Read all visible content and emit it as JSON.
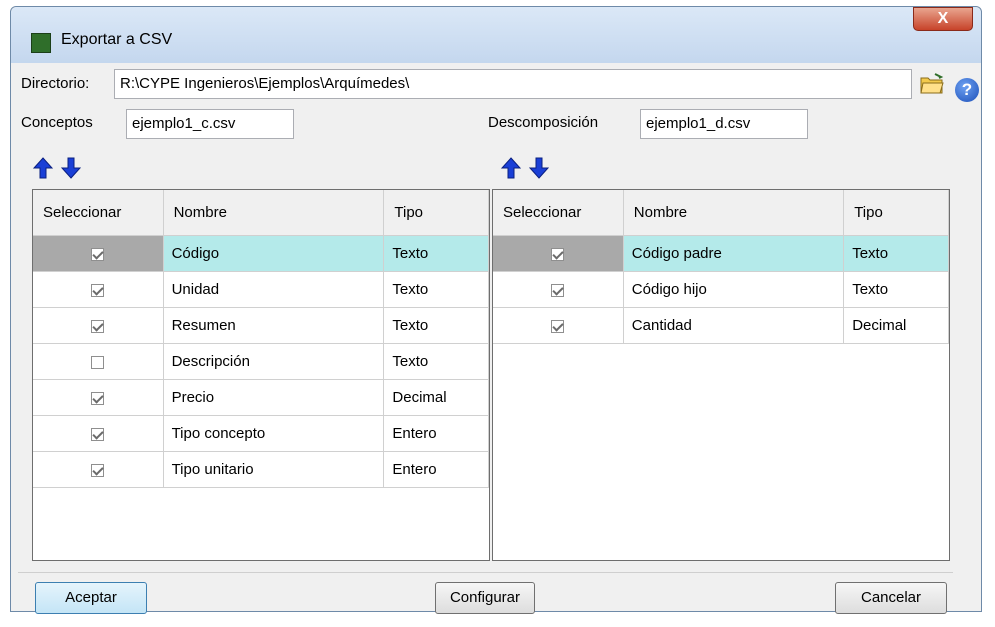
{
  "window": {
    "title": "Exportar a CSV",
    "close_glyph": "X"
  },
  "directory": {
    "label": "Directorio:",
    "value": "R:\\CYPE Ingenieros\\Ejemplos\\Arquímedes\\"
  },
  "conceptos": {
    "label": "Conceptos",
    "value": "ejemplo1_c.csv"
  },
  "descomposicion": {
    "label": "Descomposición",
    "value": "ejemplo1_d.csv"
  },
  "help_glyph": "?",
  "left_table": {
    "headers": [
      "Seleccionar",
      "Nombre",
      "Tipo"
    ],
    "rows": [
      {
        "name": "Código",
        "type": "Texto",
        "checked": true,
        "selected": true
      },
      {
        "name": "Unidad",
        "type": "Texto",
        "checked": true
      },
      {
        "name": "Resumen",
        "type": "Texto",
        "checked": true
      },
      {
        "name": "Descripción",
        "type": "Texto",
        "checked": false
      },
      {
        "name": "Precio",
        "type": "Decimal",
        "checked": true
      },
      {
        "name": "Tipo concepto",
        "type": "Entero",
        "checked": true
      },
      {
        "name": "Tipo unitario",
        "type": "Entero",
        "checked": true
      }
    ]
  },
  "right_table": {
    "headers": [
      "Seleccionar",
      "Nombre",
      "Tipo"
    ],
    "rows": [
      {
        "name": "Código padre",
        "type": "Texto",
        "checked": true,
        "selected": true
      },
      {
        "name": "Código hijo",
        "type": "Texto",
        "checked": true
      },
      {
        "name": "Cantidad",
        "type": "Decimal",
        "checked": true
      }
    ]
  },
  "buttons": {
    "accept": "Aceptar",
    "configure": "Configurar",
    "cancel": "Cancelar"
  },
  "colors": {
    "selection": "#b4eaea",
    "arrow": "#1a3fd6"
  }
}
